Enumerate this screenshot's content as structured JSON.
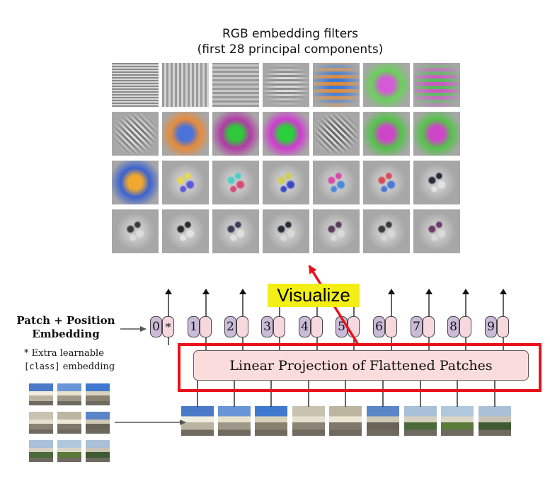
{
  "title": {
    "line1": "RGB embedding filters",
    "line2": "(first 28 principal components)"
  },
  "filters": {
    "rows": 4,
    "cols": 7,
    "cells": [
      {
        "pattern": "checker",
        "c1": "#8a8a8a",
        "c2": "#d8d8d8"
      },
      {
        "pattern": "vstripes",
        "c1": "#9a9a9a",
        "c2": "#d4d4d4"
      },
      {
        "pattern": "hstripes-soft",
        "c1": "#999",
        "c2": "#c6c6c6"
      },
      {
        "pattern": "hstripes",
        "c1": "#8a8a8a",
        "c2": "#dadada"
      },
      {
        "pattern": "hbands",
        "c1": "#e08a3a",
        "c2": "#3d7ad8"
      },
      {
        "pattern": "blob",
        "c1": "#d35bd6",
        "c2": "#6ad05a"
      },
      {
        "pattern": "hbands",
        "c1": "#cf55c8",
        "c2": "#58b85a"
      },
      {
        "pattern": "diag",
        "c1": "#7a7a7a",
        "c2": "#e2e2e2"
      },
      {
        "pattern": "blob",
        "c1": "#4a72d8",
        "c2": "#e78b3a"
      },
      {
        "pattern": "blob",
        "c1": "#2ec83a",
        "c2": "#b23aa6"
      },
      {
        "pattern": "blob",
        "c1": "#2ad03a",
        "c2": "#d03ad0"
      },
      {
        "pattern": "diag",
        "c1": "#6a6a6a",
        "c2": "#dedede"
      },
      {
        "pattern": "blob",
        "c1": "#cf45c8",
        "c2": "#54c24a"
      },
      {
        "pattern": "blob",
        "c1": "#cf45c8",
        "c2": "#54c24a"
      },
      {
        "pattern": "blob",
        "c1": "#f0a830",
        "c2": "#3a62d0"
      },
      {
        "pattern": "spots",
        "c1": "#e6d84a",
        "c2": "#5a5ad8"
      },
      {
        "pattern": "spots",
        "c1": "#4ad0c8",
        "c2": "#d84a7a"
      },
      {
        "pattern": "spots",
        "c1": "#d0d04a",
        "c2": "#3a48c8"
      },
      {
        "pattern": "spots",
        "c1": "#d84aa8",
        "c2": "#4a8ad8"
      },
      {
        "pattern": "spots",
        "c1": "#d84a58",
        "c2": "#4a7ad8"
      },
      {
        "pattern": "spots",
        "c1": "#2a2a3a",
        "c2": "#e2e2e2"
      },
      {
        "pattern": "spots",
        "c1": "#3a3a3a",
        "c2": "#dcdcdc"
      },
      {
        "pattern": "spots",
        "c1": "#2a2a2a",
        "c2": "#e4e4e4"
      },
      {
        "pattern": "spots",
        "c1": "#3a3a5a",
        "c2": "#e0e0e0"
      },
      {
        "pattern": "spots",
        "c1": "#2a2a3a",
        "c2": "#dadada"
      },
      {
        "pattern": "spots",
        "c1": "#5a3a5a",
        "c2": "#dadada"
      },
      {
        "pattern": "spots",
        "c1": "#3a3a3a",
        "c2": "#d8d8d8"
      },
      {
        "pattern": "spots",
        "c1": "#6a3a6a",
        "c2": "#dadada"
      }
    ]
  },
  "visualize_label": "Visualize",
  "patch_position_label": {
    "line1": "Patch + Position",
    "line2": "Embedding"
  },
  "extra_note": {
    "line1": "* Extra learnable",
    "code": "[class]",
    "line2_suffix": " embedding"
  },
  "projection_label": "Linear Projection of Flattened Patches",
  "tokens": [
    {
      "num": "0",
      "ext": "*"
    },
    {
      "num": "1",
      "ext": ""
    },
    {
      "num": "2",
      "ext": ""
    },
    {
      "num": "3",
      "ext": ""
    },
    {
      "num": "4",
      "ext": ""
    },
    {
      "num": "5",
      "ext": ""
    },
    {
      "num": "6",
      "ext": ""
    },
    {
      "num": "7",
      "ext": ""
    },
    {
      "num": "8",
      "ext": ""
    },
    {
      "num": "9",
      "ext": ""
    }
  ],
  "colors": {
    "accent_red": "#e8111a",
    "highlight_yellow": "#f3ef15",
    "projection_fill": "#f9dcdb",
    "token_number_fill": "#cbbbd9",
    "token_embed_fill": "#f7d8df",
    "arrow": "#111111"
  }
}
